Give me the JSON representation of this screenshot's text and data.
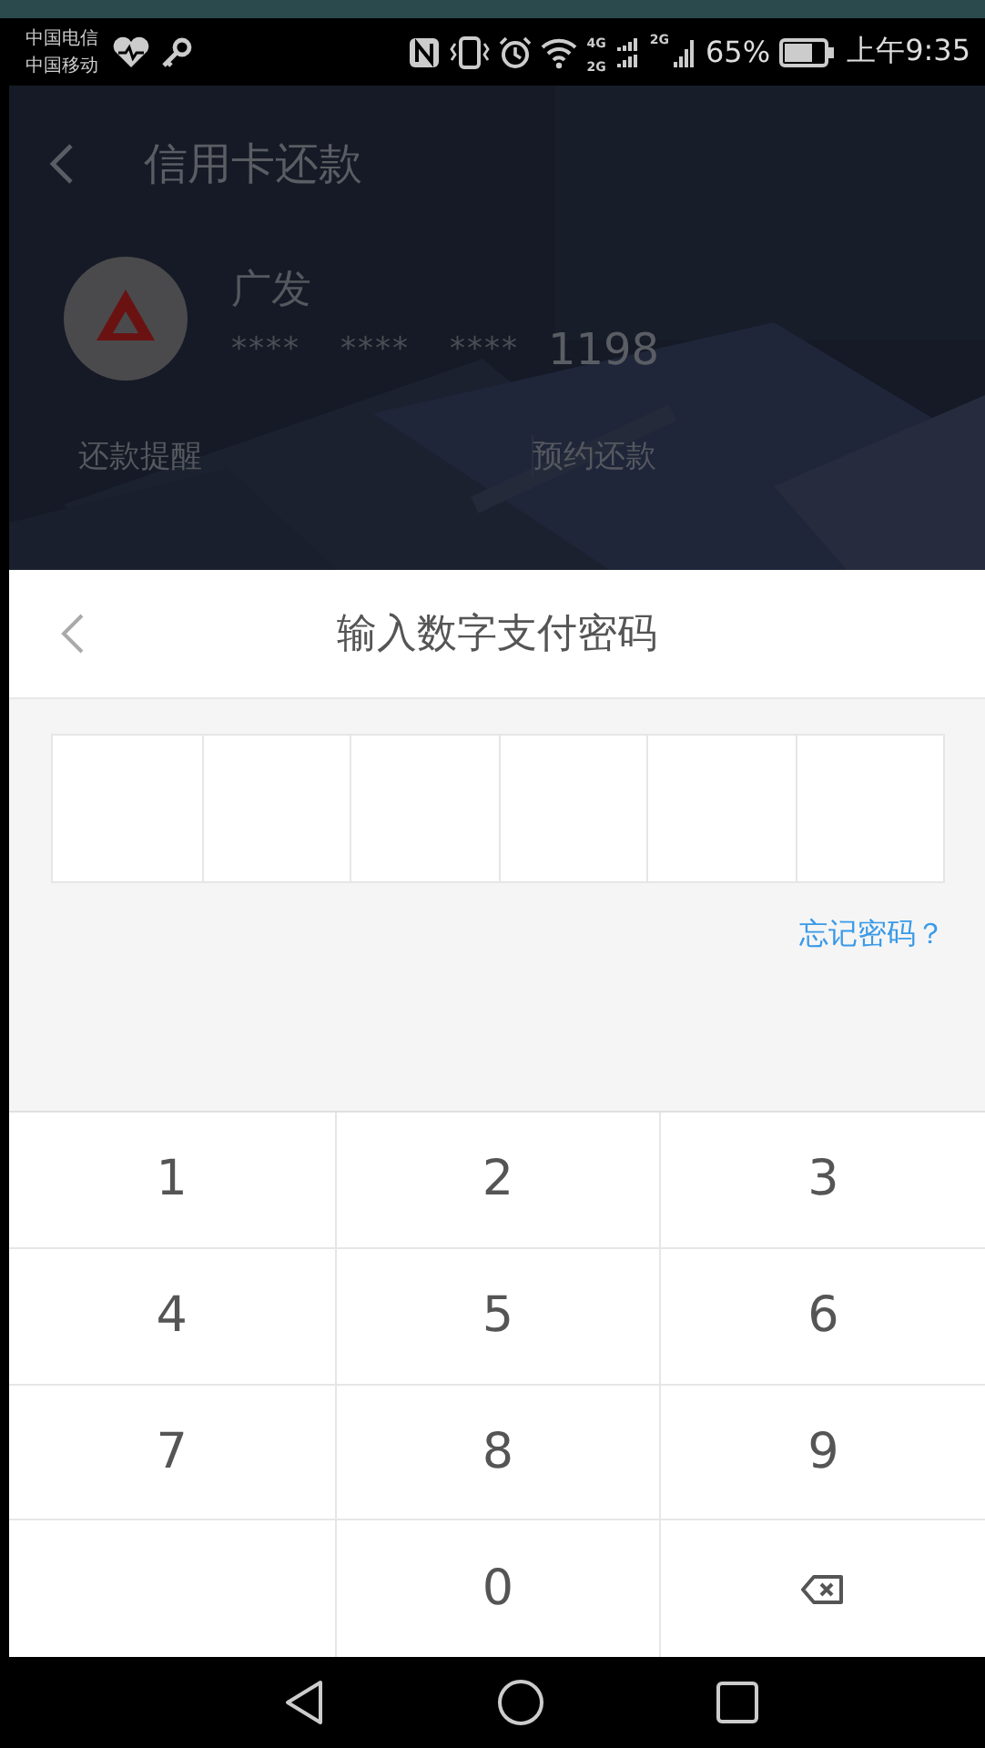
{
  "status_bar": {
    "carriers": [
      "中国电信",
      "中国移动"
    ],
    "network_labels": [
      "4G",
      "2G",
      "2G"
    ],
    "battery_text": "65%",
    "time": "上午9:35"
  },
  "app": {
    "title": "信用卡还款",
    "card": {
      "bank_name": "广发",
      "masked_groups": [
        "****",
        "****",
        "****"
      ],
      "last_digits": "1198"
    },
    "options": [
      "还款提醒",
      "预约还款"
    ]
  },
  "dialog": {
    "title": "输入数字支付密码",
    "password_slots": [
      {
        "filled": false
      },
      {
        "filled": false
      },
      {
        "filled": false
      },
      {
        "filled": false
      },
      {
        "filled": false
      },
      {
        "filled": false
      }
    ],
    "forgot_link": "忘记密码？",
    "keys": [
      {
        "kind": "digit",
        "label": "1"
      },
      {
        "kind": "digit",
        "label": "2"
      },
      {
        "kind": "digit",
        "label": "3"
      },
      {
        "kind": "digit",
        "label": "4"
      },
      {
        "kind": "digit",
        "label": "5"
      },
      {
        "kind": "digit",
        "label": "6"
      },
      {
        "kind": "digit",
        "label": "7"
      },
      {
        "kind": "digit",
        "label": "8"
      },
      {
        "kind": "digit",
        "label": "9"
      },
      {
        "kind": "blank"
      },
      {
        "kind": "digit",
        "label": "0"
      },
      {
        "kind": "backspace"
      }
    ]
  }
}
